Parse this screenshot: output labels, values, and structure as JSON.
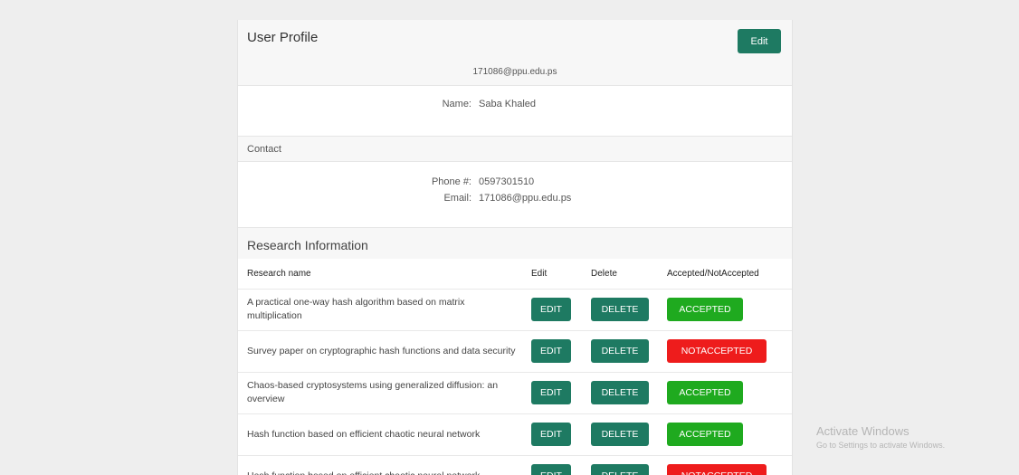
{
  "profile": {
    "title": "User Profile",
    "edit_label": "Edit",
    "email_display": "171086@ppu.edu.ps",
    "name_label": "Name:",
    "name_value": "Saba Khaled"
  },
  "contact": {
    "heading": "Contact",
    "phone_label": "Phone #:",
    "phone_value": "0597301510",
    "email_label": "Email:",
    "email_value": "171086@ppu.edu.ps"
  },
  "research": {
    "heading": "Research Information",
    "columns": [
      "Research name",
      "Edit",
      "Delete",
      "Accepted/NotAccepted"
    ],
    "rows": [
      {
        "name": "A practical one-way hash algorithm based on matrix multiplication",
        "edit": "EDIT",
        "delete": "DELETE",
        "status": "ACCEPTED",
        "accepted": true
      },
      {
        "name": "Survey paper on cryptographic hash functions and data security",
        "edit": "EDIT",
        "delete": "DELETE",
        "status": "NOTACCEPTED",
        "accepted": false
      },
      {
        "name": "Chaos-based cryptosystems using generalized diffusion: an overview",
        "edit": "EDIT",
        "delete": "DELETE",
        "status": "ACCEPTED",
        "accepted": true
      },
      {
        "name": "Hash function based on efficient chaotic neural network",
        "edit": "EDIT",
        "delete": "DELETE",
        "status": "ACCEPTED",
        "accepted": true
      },
      {
        "name": "Hash function based on efficient chaotic neural network",
        "edit": "EDIT",
        "delete": "DELETE",
        "status": "NOTACCEPTED",
        "accepted": false
      }
    ]
  },
  "watermark": {
    "line1": "Activate Windows",
    "line2": "Go to Settings to activate Windows."
  },
  "colors": {
    "primary": "#1e7a62",
    "accepted": "#1faa1f",
    "not_accepted": "#ee1c1c"
  }
}
